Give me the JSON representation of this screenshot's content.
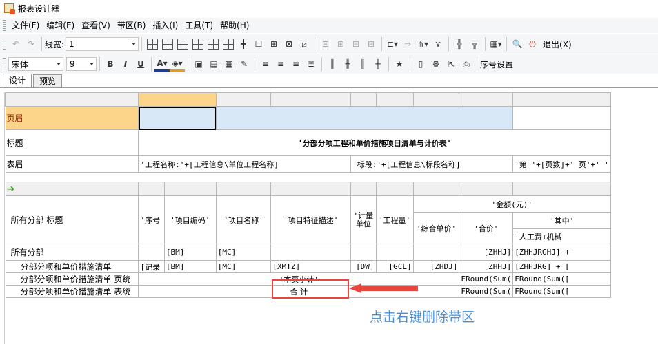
{
  "window": {
    "title": "报表设计器"
  },
  "menu": [
    "文件(F)",
    "编辑(E)",
    "查看(V)",
    "带区(B)",
    "插入(I)",
    "工具(T)",
    "帮助(H)"
  ],
  "toolbar1": {
    "line_width_label": "线宽:",
    "line_width_value": "1",
    "exit_label": "退出(X)"
  },
  "toolbar2": {
    "font_value": "宋体",
    "size_value": "9",
    "bold": "B",
    "italic": "I",
    "underline": "U",
    "seq_label": "序号设置"
  },
  "tabs": [
    "设计",
    "预览"
  ],
  "bands": {
    "page_header": "页眉",
    "title": "标题",
    "table_header": "表眉",
    "group_header": "所有分部 标题",
    "all_parts": "所有分部",
    "detail": "分部分项和单价措施清单",
    "page_total": "分部分项和单价措施清单 页统",
    "table_total": "分部分项和单价措施清单 表统"
  },
  "report": {
    "title": "'分部分项工程和单价措施项目清单与计价表'",
    "project_name": "'工程名称:'+[工程信息\\单位工程名称]",
    "section": "'标段:'+[工程信息\\标段名称]",
    "page_no": "'第 '+[页数]+' 页'+' '"
  },
  "columns": {
    "seq": "'序号",
    "code": "'项目编码'",
    "name": "'项目名称'",
    "feature": "'项目特征描述'",
    "unit": "'计量单位",
    "qty": "'工程量'",
    "amount": "'金额(元)'",
    "unit_price": "'综合单价'",
    "total": "'合价'",
    "of_which": "'其中'",
    "labor_machine": "'人工费+机械"
  },
  "rows": {
    "all_bm": "[BM]",
    "all_mc": "[MC]",
    "all_zhhj": "[ZHHJ]",
    "all_zhhjrg": "[ZHHJRGHJ] +",
    "det_seq": "[记录",
    "det_bm": "[BM]",
    "det_mc": "[MC]",
    "det_xmtz": "[XMTZ]",
    "det_dw": "[DW]",
    "det_gcl": "[GCL]",
    "det_zhdj": "[ZHDJ]",
    "det_zhhj": "[ZHHJ]",
    "det_zhhjrg": "[ZHHJRG] + [",
    "page_subtotal": "'本页小计'",
    "page_sum1": "FRound(Sum(",
    "page_sum2": "FRound(Sum([",
    "table_total_label": "合  计",
    "table_sum1": "FRound(Sum(",
    "table_sum2": "FRound(Sum(["
  },
  "annotation": {
    "note": "点击右键删除带区",
    "color": "#e8453c",
    "note_color": "#4a90d9"
  }
}
